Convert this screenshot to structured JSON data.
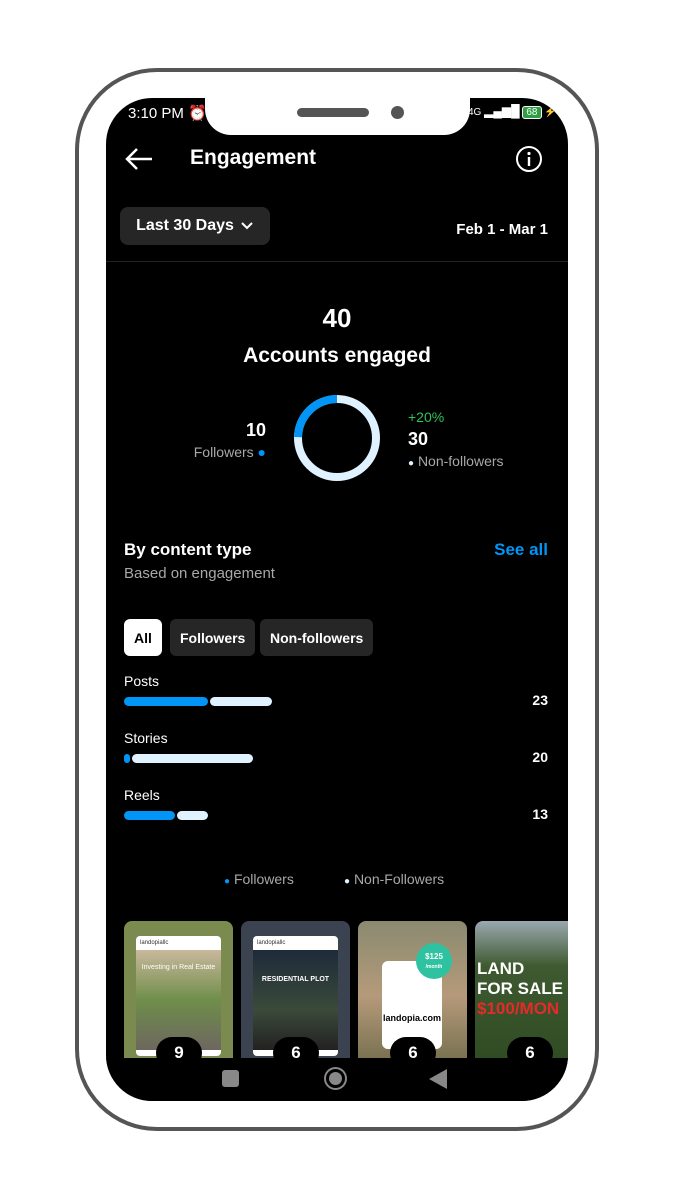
{
  "status": {
    "time": "3:10 PM",
    "network": "4G",
    "battery": "68"
  },
  "header": {
    "title": "Engagement"
  },
  "filter": {
    "range": "Last 30 Days",
    "dates": "Feb 1 - Mar 1"
  },
  "summary": {
    "total": "40",
    "label": "Accounts engaged",
    "followers_count": "10",
    "followers_label": "Followers",
    "nonfollowers_change": "+20%",
    "nonfollowers_count": "30",
    "nonfollowers_label": "Non-followers",
    "followers_fraction": 0.25
  },
  "content": {
    "title": "By content type",
    "subtitle": "Based on engagement",
    "see_all": "See all",
    "chips": [
      "All",
      "Followers",
      "Non-followers"
    ],
    "rows": [
      {
        "label": "Posts",
        "total": "23",
        "followers": 13,
        "value": 23
      },
      {
        "label": "Stories",
        "total": "20",
        "followers": 1,
        "value": 20
      },
      {
        "label": "Reels",
        "total": "13",
        "followers": 8,
        "value": 13
      }
    ],
    "legend": [
      "Followers",
      "Non-Followers"
    ]
  },
  "colors": {
    "followers": "#0095f6",
    "nonfollowers": "#e0f1ff",
    "accent": "#0095f6",
    "positive": "#2fc25b"
  },
  "thumbnails": [
    {
      "count": "9",
      "brand": "landopiallc",
      "headline": "Investing in Real Estate"
    },
    {
      "count": "6",
      "brand": "landopiallc",
      "headline": "RESIDENTIAL PLOT"
    },
    {
      "count": "6",
      "price": "$125",
      "per": "/month",
      "site": "landopia.com"
    },
    {
      "count": "6",
      "line1": "LAND",
      "line2": "FOR SALE",
      "line3": "$100/MON"
    }
  ]
}
